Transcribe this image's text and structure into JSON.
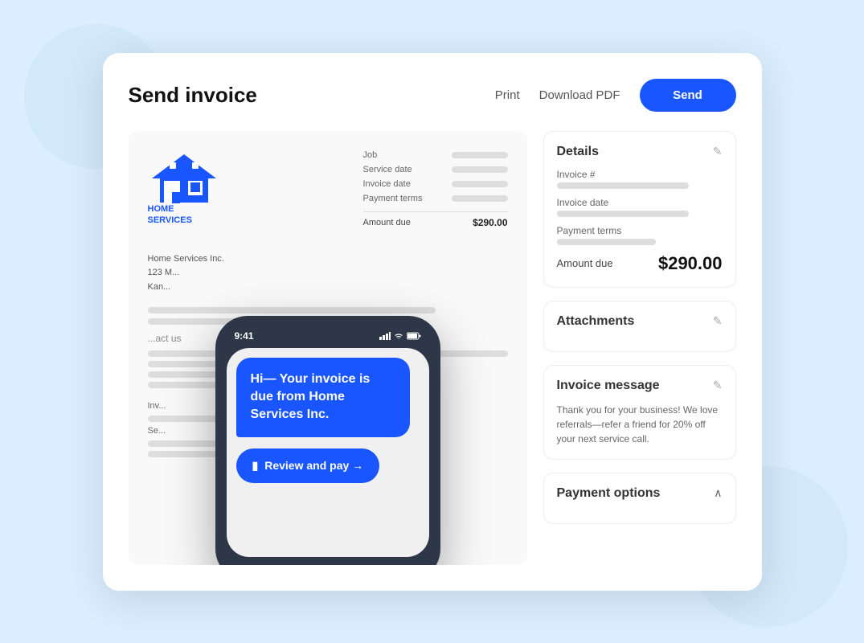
{
  "header": {
    "title": "Send invoice",
    "print_label": "Print",
    "download_label": "Download PDF",
    "send_label": "Send"
  },
  "invoice": {
    "company": "Home Services Inc.",
    "address1": "123 M...",
    "address2": "Kan...",
    "contact_label": "...act us",
    "fields": {
      "job_label": "Job",
      "service_date_label": "Service date",
      "invoice_date_label": "Invoice date",
      "payment_terms_label": "Payment terms",
      "amount_due_label": "Amount due",
      "amount_due_value": "$290.00"
    }
  },
  "phone": {
    "time": "9:41",
    "message": "Hi— Your invoice is due from Home Services Inc.",
    "review_button": "Review and pay →"
  },
  "details_panel": {
    "title": "Details",
    "invoice_number_label": "Invoice #",
    "invoice_date_label": "Invoice date",
    "payment_terms_label": "Payment terms",
    "amount_due_label": "Amount due",
    "amount_due_value": "$290.00"
  },
  "attachments_panel": {
    "title": "Attachments"
  },
  "invoice_message_panel": {
    "title": "Invoice message",
    "message": "Thank you for your business! We love referrals—refer a friend for 20% off your next service call."
  },
  "payment_options_panel": {
    "title": "Payment options"
  }
}
